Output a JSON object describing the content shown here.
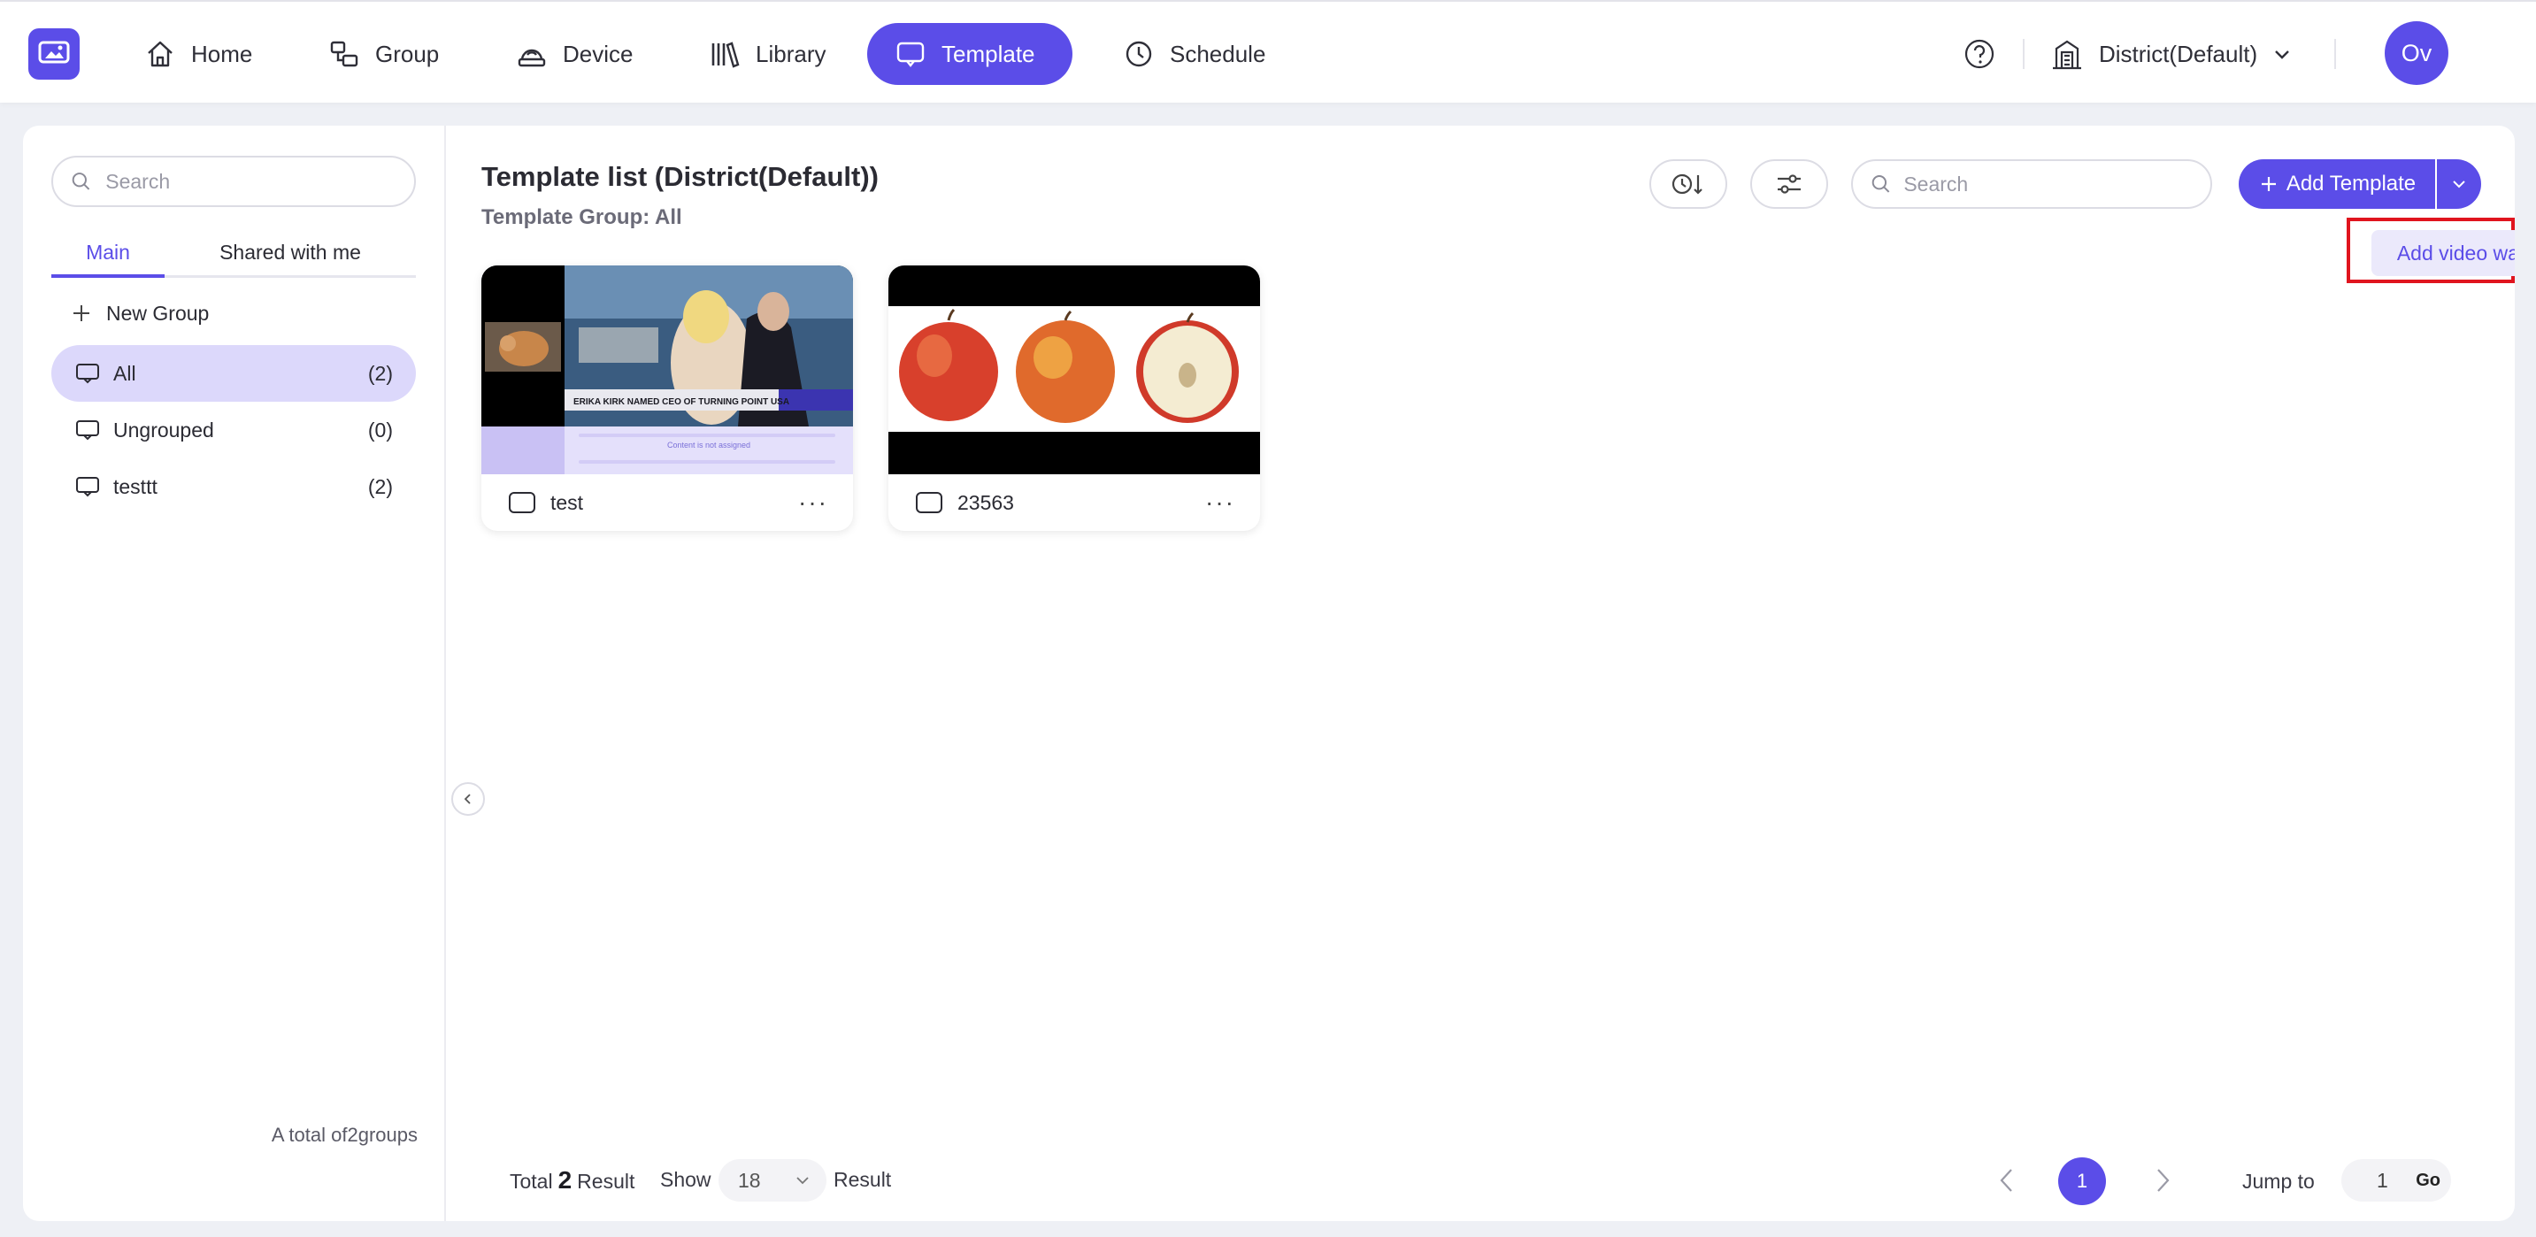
{
  "nav": {
    "items": [
      {
        "label": "Home",
        "icon": "home-icon"
      },
      {
        "label": "Group",
        "icon": "group-icon"
      },
      {
        "label": "Device",
        "icon": "device-icon"
      },
      {
        "label": "Library",
        "icon": "library-icon"
      },
      {
        "label": "Template",
        "icon": "template-icon",
        "active": true
      },
      {
        "label": "Schedule",
        "icon": "clock-icon"
      }
    ],
    "district": "District(Default)",
    "avatar": "Ov"
  },
  "sidebar": {
    "search_placeholder": "Search",
    "tabs": [
      "Main",
      "Shared with me"
    ],
    "new_group": "New Group",
    "groups": [
      {
        "name": "All",
        "count": "(2)",
        "active": true
      },
      {
        "name": "Ungrouped",
        "count": "(0)"
      },
      {
        "name": "testtt",
        "count": "(2)"
      }
    ],
    "total_prefix": "A total of",
    "total_count": "2",
    "total_suffix": "groups"
  },
  "main": {
    "title": "Template list (District(Default))",
    "subtitle": "Template Group: All",
    "search_placeholder": "Search",
    "add_button": "Add Template",
    "dropdown_item": "Add video wall",
    "cards": [
      {
        "name": "test",
        "thumb": {
          "headline": "ERIKA KIRK NAMED CEO OF TURNING POINT USA",
          "unassigned": "Content is not assigned"
        }
      },
      {
        "name": "23563"
      }
    ]
  },
  "footer": {
    "total_label": "Total",
    "total_count": "2",
    "result_label": "Result",
    "show_label": "Show",
    "show_value": "18",
    "page": "1",
    "jump_label": "Jump to",
    "jump_value": "1",
    "go_label": "Go"
  },
  "colors": {
    "accent": "#5b4de8",
    "accent_light": "#dcd8fb",
    "highlight_border": "#e0141e"
  }
}
